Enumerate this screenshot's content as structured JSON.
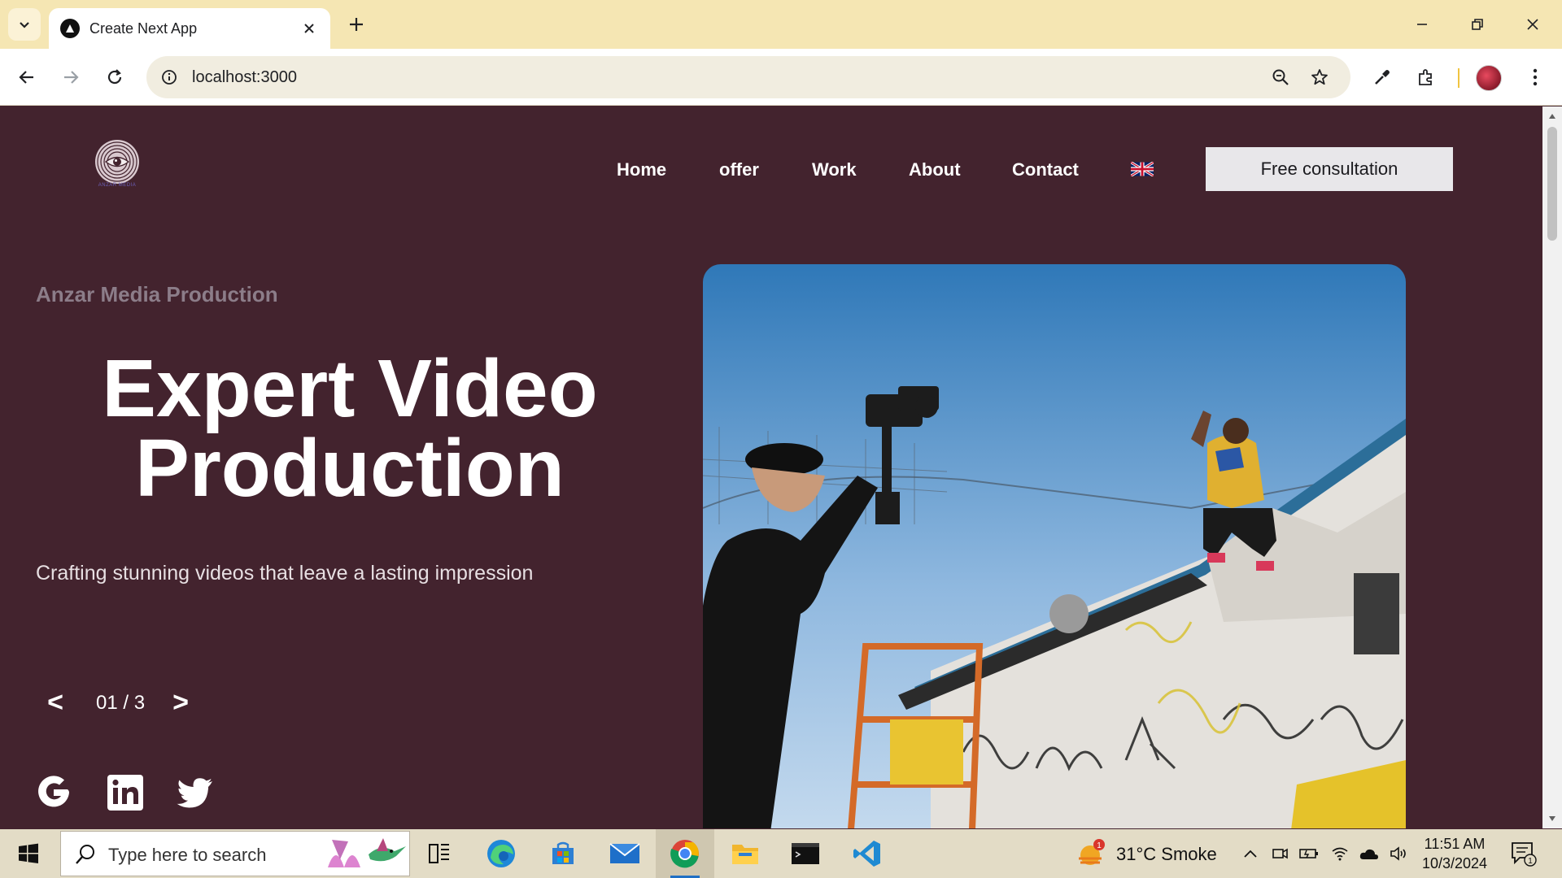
{
  "browser": {
    "tab_title": "Create Next App",
    "url": "localhost:3000"
  },
  "site": {
    "logo_text": "ANZAR MEDIA",
    "nav": [
      "Home",
      "offer",
      "Work",
      "About",
      "Contact"
    ],
    "language_flag": "uk-flag-icon",
    "cta_label": "Free consultation"
  },
  "hero": {
    "kicker": "Anzar Media Production",
    "headline_line1": "Expert Video",
    "headline_line2": "Production",
    "subline": "Crafting stunning videos that leave a lasting impression",
    "slider": {
      "prev": "<",
      "next": ">",
      "counter": "01 / 3"
    },
    "social_icons": [
      "google-icon",
      "linkedin-icon",
      "twitter-icon"
    ]
  },
  "taskbar": {
    "search_placeholder": "Type here to search",
    "weather": "31°C  Smoke",
    "weather_badge": "1",
    "time": "11:51 AM",
    "date": "10/3/2024",
    "notification_count": "1"
  },
  "colors": {
    "page_bg": "#43232e",
    "tabbar_bg": "#f5e6b3",
    "cta_bg": "#e8e7ea",
    "kicker": "#8c7d89"
  }
}
